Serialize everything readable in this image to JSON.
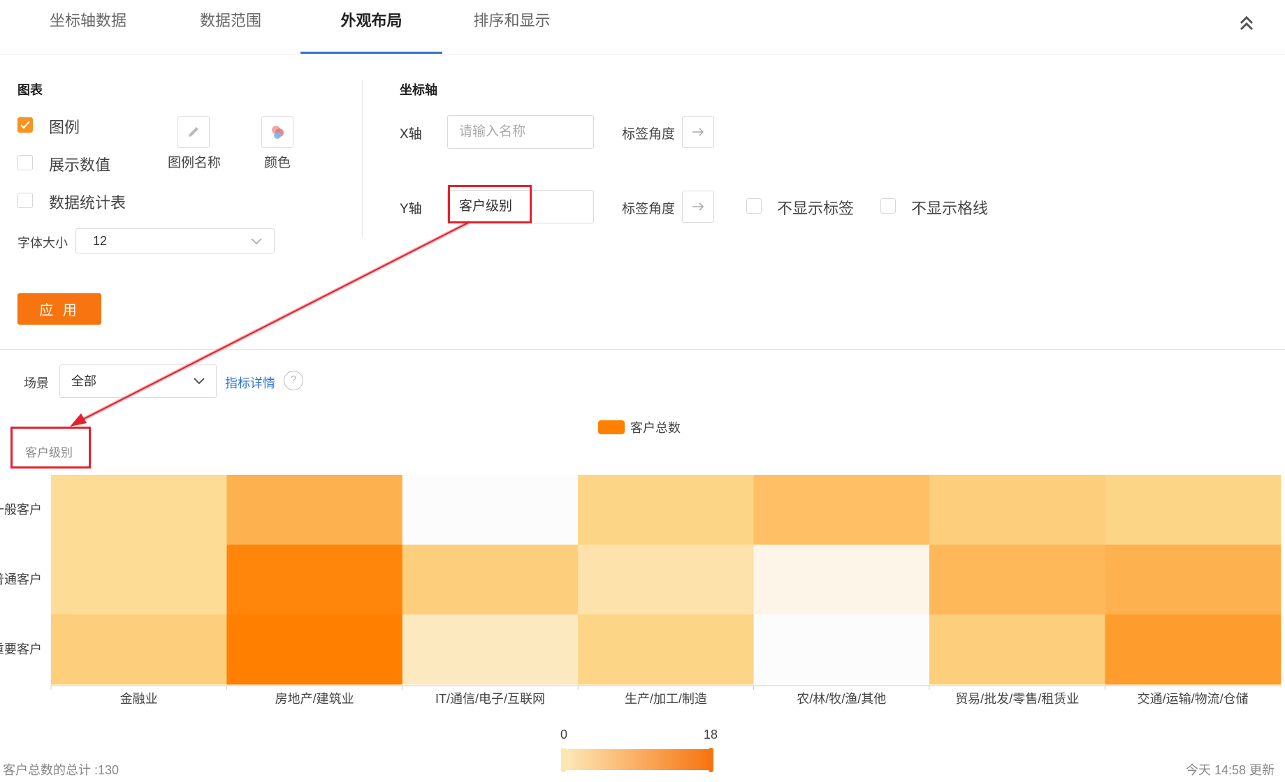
{
  "tabs": [
    "坐标轴数据",
    "数据范围",
    "外观布局",
    "排序和显示"
  ],
  "chart_panel": {
    "title": "图表",
    "legend_label": "图例",
    "legend_checked": true,
    "show_values_label": "展示数值",
    "stats_table_label": "数据统计表",
    "legend_name_label": "图例名称",
    "color_label": "颜色",
    "font_size_label": "字体大小",
    "font_size_value": "12",
    "apply_label": "应 用"
  },
  "axis_panel": {
    "title": "坐标轴",
    "x_label": "X轴",
    "x_placeholder": "请输入名称",
    "x_value": "",
    "label_angle": "标签角度",
    "y_label": "Y轴",
    "y_value": "客户级别",
    "hide_labels": "不显示标签",
    "hide_gridlines": "不显示格线"
  },
  "filter": {
    "scene_label": "场景",
    "scene_value": "全部",
    "metric_details": "指标详情",
    "help_icon": "?"
  },
  "colors": {
    "accent": "#f77410",
    "tab_active": "#2f73d6",
    "highlight": "#e3212d",
    "heat_low": "#fdfcfc",
    "heat_high": "#ff7f00"
  },
  "chart_data": {
    "type": "heatmap",
    "ylabel": "客户级别",
    "legend": "客户总数",
    "x_categories": [
      "金融业",
      "房地产/建筑业",
      "IT/通信/电子/互联网",
      "生产/加工/制造",
      "农/林/牧/渔/其他",
      "贸易/批发/零售/租赁业",
      "交通/运输/物流/仓储"
    ],
    "y_categories": [
      "一般客户",
      "普通客户",
      "重要客户"
    ],
    "values": [
      [
        5,
        11,
        0,
        6,
        9,
        7,
        6
      ],
      [
        5,
        17,
        7,
        4,
        1,
        10,
        11
      ],
      [
        7,
        18,
        3,
        6,
        0,
        7,
        14
      ]
    ],
    "visual_map": {
      "min": 0,
      "max": 18,
      "min_label": "0",
      "max_label": "18"
    }
  },
  "footer": {
    "total": "客户总数的总计 :130",
    "updated": "今天 14:58 更新"
  }
}
